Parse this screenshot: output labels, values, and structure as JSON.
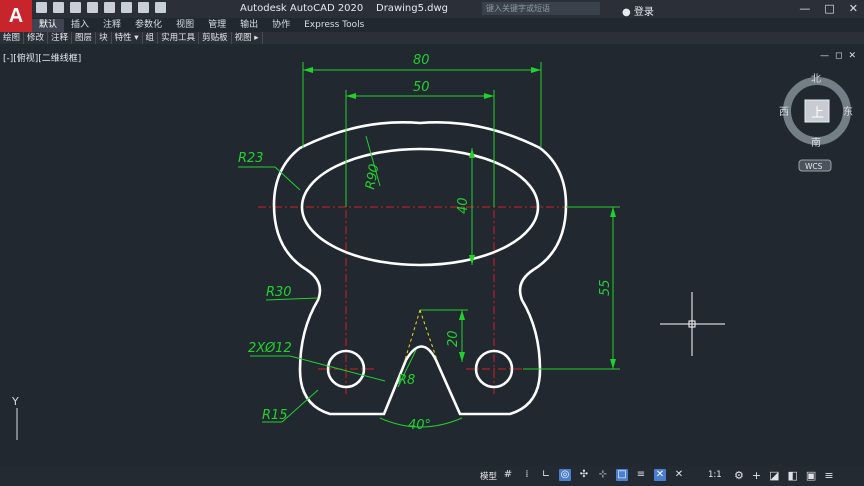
{
  "app": {
    "logo": "A",
    "title": "Autodesk AutoCAD 2020",
    "file": "Drawing5.dwg",
    "search_placeholder": "键入关键字或短语",
    "login": "登录",
    "minimize": "—",
    "maximize": "□",
    "close": "✕"
  },
  "ribbon_tabs": [
    "默认",
    "插入",
    "注释",
    "参数化",
    "视图",
    "管理",
    "输出",
    "协作",
    "Express Tools"
  ],
  "panels": [
    "绘图",
    "修改",
    "注释",
    "图层",
    "块",
    "特性 ▾",
    "组",
    "实用工具",
    "剪贴板",
    "视图 ▸"
  ],
  "viewport": {
    "label": "[-][俯视][二维线框]",
    "min": "—",
    "restore": "◻",
    "close": "✕"
  },
  "viewcube": {
    "north": "北",
    "south": "南",
    "east": "东",
    "west": "西",
    "face": "上",
    "wcs": "WCS"
  },
  "ucs_y": "Y",
  "dimensions": {
    "d80": "80",
    "d50": "50",
    "r90": "R90",
    "d40": "40",
    "r23": "R23",
    "r30": "R30",
    "d55": "55",
    "d20": "20",
    "holes": "2XØ12",
    "r8": "R8",
    "r15": "R15",
    "angle": "40°"
  },
  "status": {
    "model": "模型",
    "scale": "1:1"
  },
  "colors": {
    "accent_red": "#c8242b",
    "dimension_green": "#22d12e",
    "centerline_red": "#d81e1e",
    "outline_white": "#ffffff",
    "canvas_bg": "#212830"
  }
}
